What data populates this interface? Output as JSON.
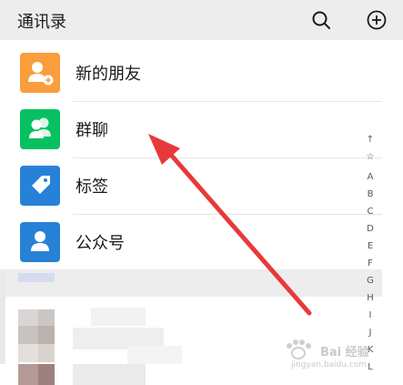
{
  "header": {
    "title": "通讯录",
    "background": "#ededed"
  },
  "icons": {
    "search": "search-icon",
    "add": "plus-circle-icon"
  },
  "rows": [
    {
      "label": "新的朋友",
      "icon": "add-friend-icon",
      "color": "#fa9d3b"
    },
    {
      "label": "群聊",
      "icon": "group-chat-icon",
      "color": "#07c160"
    },
    {
      "label": "标签",
      "icon": "tag-icon",
      "color": "#2782d7"
    },
    {
      "label": "公众号",
      "icon": "official-account-icon",
      "color": "#2782d7"
    }
  ],
  "index_bar": [
    "↑",
    "☆",
    "A",
    "B",
    "C",
    "D",
    "E",
    "F",
    "G",
    "H",
    "I",
    "J",
    "K",
    "L"
  ],
  "annotation": {
    "color": "#e8393a"
  },
  "watermark": {
    "text": "Bai 经验",
    "sub": "jingyan.baidu.com"
  }
}
